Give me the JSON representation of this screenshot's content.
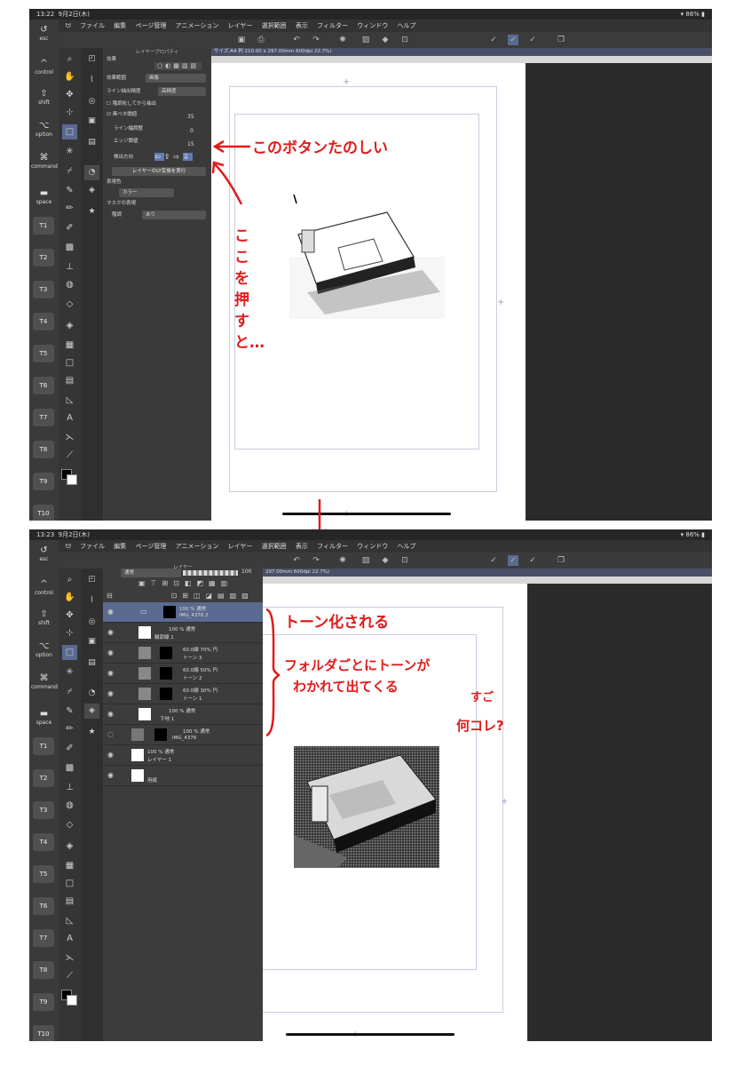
{
  "top": {
    "status": {
      "time": "13:22",
      "date": "9月2日(木)",
      "battery": "86%"
    },
    "keys": {
      "esc": "esc",
      "control": "control",
      "shift": "shift",
      "option": "option",
      "command": "command",
      "space": "space",
      "t": [
        "T1",
        "T2",
        "T3",
        "T4",
        "T5",
        "T6",
        "T7",
        "T8",
        "T9",
        "T10"
      ]
    },
    "menu": [
      "ファイル",
      "編集",
      "ページ管理",
      "アニメーション",
      "レイヤー",
      "選択範囲",
      "表示",
      "フィルター",
      "ウィンドウ",
      "ヘルプ"
    ],
    "panel": {
      "title": "レイヤープロパティ",
      "effect": "効果",
      "effect_range": "効果範囲",
      "effect_range_value": "画像",
      "line_precision": "ライン抽出精度",
      "line_precision_value": "高精度",
      "brightness_first": "階調化してから抽出",
      "black_threshold": "黒ベタ閾値",
      "black_threshold_value": "35",
      "line_width": "ライン幅調整",
      "line_width_value": "0",
      "edge_threshold": "エッジ閾値",
      "edge_threshold_value": "15",
      "direction": "検出方向",
      "run_button": "レイヤーのLT変換を実行",
      "expression_color": "表現色",
      "expression_color_value": "カラー",
      "mask_expression": "マスクの表現",
      "mask_label": "階調",
      "mask_value": "あり"
    },
    "canvas_info": "サイズ:A4 判 210.00 x 297.00mm 600dpi 22.7%)",
    "annotations": {
      "button_fun": "このボタンたのしい",
      "press": "ここを押すと…"
    }
  },
  "bottom": {
    "status": {
      "time": "13:23",
      "date": "9月2日(木)",
      "battery": "86%"
    },
    "menu": [
      "ファイル",
      "編集",
      "ページ管理",
      "アニメーション",
      "レイヤー",
      "選択範囲",
      "表示",
      "フィルター",
      "ウィンドウ",
      "ヘルプ"
    ],
    "canvas_info": "297.00mm 600dpi 22.7%)",
    "layer_panel": {
      "title": "レイヤー",
      "blend_mode": "通常",
      "opacity": "100",
      "layers": [
        {
          "line1": "100 % 通常",
          "line2": "IMG_4376 2",
          "indent": 0,
          "selected": true
        },
        {
          "line1": "100 % 通常",
          "line2": "輪郭線 1",
          "indent": 1,
          "selected": false
        },
        {
          "line1": "60.0線 70% 円",
          "line2": "トーン 3",
          "indent": 1,
          "selected": false
        },
        {
          "line1": "60.0線 50% 円",
          "line2": "トーン 2",
          "indent": 1,
          "selected": false
        },
        {
          "line1": "60.0線 30% 円",
          "line2": "トーン 1",
          "indent": 1,
          "selected": false
        },
        {
          "line1": "100 % 通常",
          "line2": "下地 1",
          "indent": 1,
          "selected": false
        },
        {
          "line1": "100 % 通常",
          "line2": "IMG_4376",
          "indent": 0,
          "selected": false
        },
        {
          "line1": "100 % 通常",
          "line2": "レイヤー 1",
          "indent": 0,
          "selected": false
        },
        {
          "line1": "",
          "line2": "用紙",
          "indent": 0,
          "selected": false
        }
      ]
    },
    "annotations": {
      "toned": "トーン化される",
      "folder1": "フォルダごとにトーンが",
      "folder2": "わかれて出てくる",
      "whoa": "すご",
      "what": "何コレ?"
    }
  }
}
